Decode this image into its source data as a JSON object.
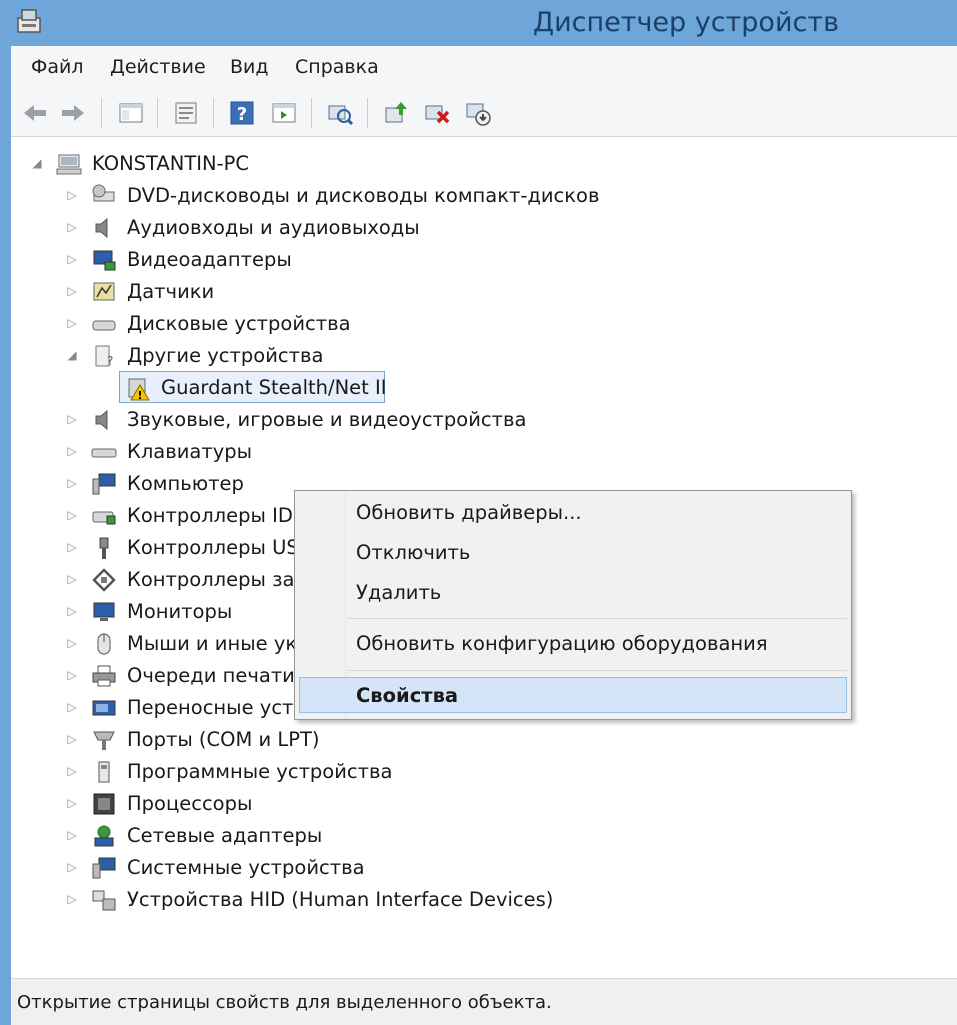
{
  "window": {
    "title": "Диспетчер устройств"
  },
  "menu": [
    "Файл",
    "Действие",
    "Вид",
    "Справка"
  ],
  "toolbar": {
    "buttons": [
      {
        "icon": "back-arrow-icon"
      },
      {
        "icon": "forward-arrow-icon"
      },
      {
        "icon": "console-tree-icon"
      },
      {
        "icon": "properties-icon"
      },
      {
        "icon": "help-icon"
      },
      {
        "icon": "action-pane-icon"
      },
      {
        "icon": "scan-hardware-icon"
      },
      {
        "icon": "update-driver-icon"
      },
      {
        "icon": "uninstall-device-icon"
      },
      {
        "icon": "disable-device-icon"
      }
    ]
  },
  "tree": {
    "root": "KONSTANTIN-PC",
    "items": [
      {
        "label": "DVD-дисководы и дисководы компакт-дисков",
        "icon": "dvd-drive-icon",
        "expanded": false
      },
      {
        "label": "Аудиовходы и аудиовыходы",
        "icon": "speaker-icon",
        "expanded": false
      },
      {
        "label": "Видеоадаптеры",
        "icon": "display-adapter-icon",
        "expanded": false
      },
      {
        "label": "Датчики",
        "icon": "sensor-icon",
        "expanded": false
      },
      {
        "label": "Дисковые устройства",
        "icon": "disk-drive-icon",
        "expanded": false
      },
      {
        "label": "Другие устройства",
        "icon": "unknown-device-icon",
        "expanded": true
      },
      {
        "label": "Guardant Stealth/Net II",
        "icon": "warning-device-icon",
        "child": true
      },
      {
        "label": "Звуковые, игровые и видеоустройства",
        "icon": "speaker-icon",
        "expanded": false
      },
      {
        "label": "Клавиатуры",
        "icon": "keyboard-icon",
        "expanded": false
      },
      {
        "label": "Компьютер",
        "icon": "computer-icon",
        "expanded": false
      },
      {
        "label": "Контроллеры IDE ATA/ATAPI",
        "icon": "ide-controller-icon",
        "expanded": false
      },
      {
        "label": "Контроллеры USB",
        "icon": "usb-icon",
        "expanded": false
      },
      {
        "label": "Контроллеры запоминающих устройств",
        "icon": "storage-controller-icon",
        "expanded": false
      },
      {
        "label": "Мониторы",
        "icon": "monitor-icon",
        "expanded": false
      },
      {
        "label": "Мыши и иные указывающие устройства",
        "icon": "mouse-icon",
        "expanded": false
      },
      {
        "label": "Очереди печати",
        "icon": "printer-icon",
        "expanded": false
      },
      {
        "label": "Переносные устройства",
        "icon": "portable-device-icon",
        "expanded": false
      },
      {
        "label": "Порты (COM и LPT)",
        "icon": "port-icon",
        "expanded": false
      },
      {
        "label": "Программные устройства",
        "icon": "software-device-icon",
        "expanded": false
      },
      {
        "label": "Процессоры",
        "icon": "processor-icon",
        "expanded": false
      },
      {
        "label": "Сетевые адаптеры",
        "icon": "network-adapter-icon",
        "expanded": false
      },
      {
        "label": "Системные устройства",
        "icon": "system-device-icon",
        "expanded": false
      },
      {
        "label": "Устройства HID (Human Interface Devices)",
        "icon": "hid-device-icon",
        "expanded": false
      }
    ]
  },
  "context_menu": {
    "items": [
      "Обновить драйверы...",
      "Отключить",
      "Удалить",
      "Обновить конфигурацию оборудования",
      "Свойства"
    ],
    "highlighted": "Свойства"
  },
  "status": "Открытие страницы свойств для выделенного объекта.",
  "colors": {
    "titlebar": "#6fa6d9",
    "highlight": "#d4e5f7"
  }
}
